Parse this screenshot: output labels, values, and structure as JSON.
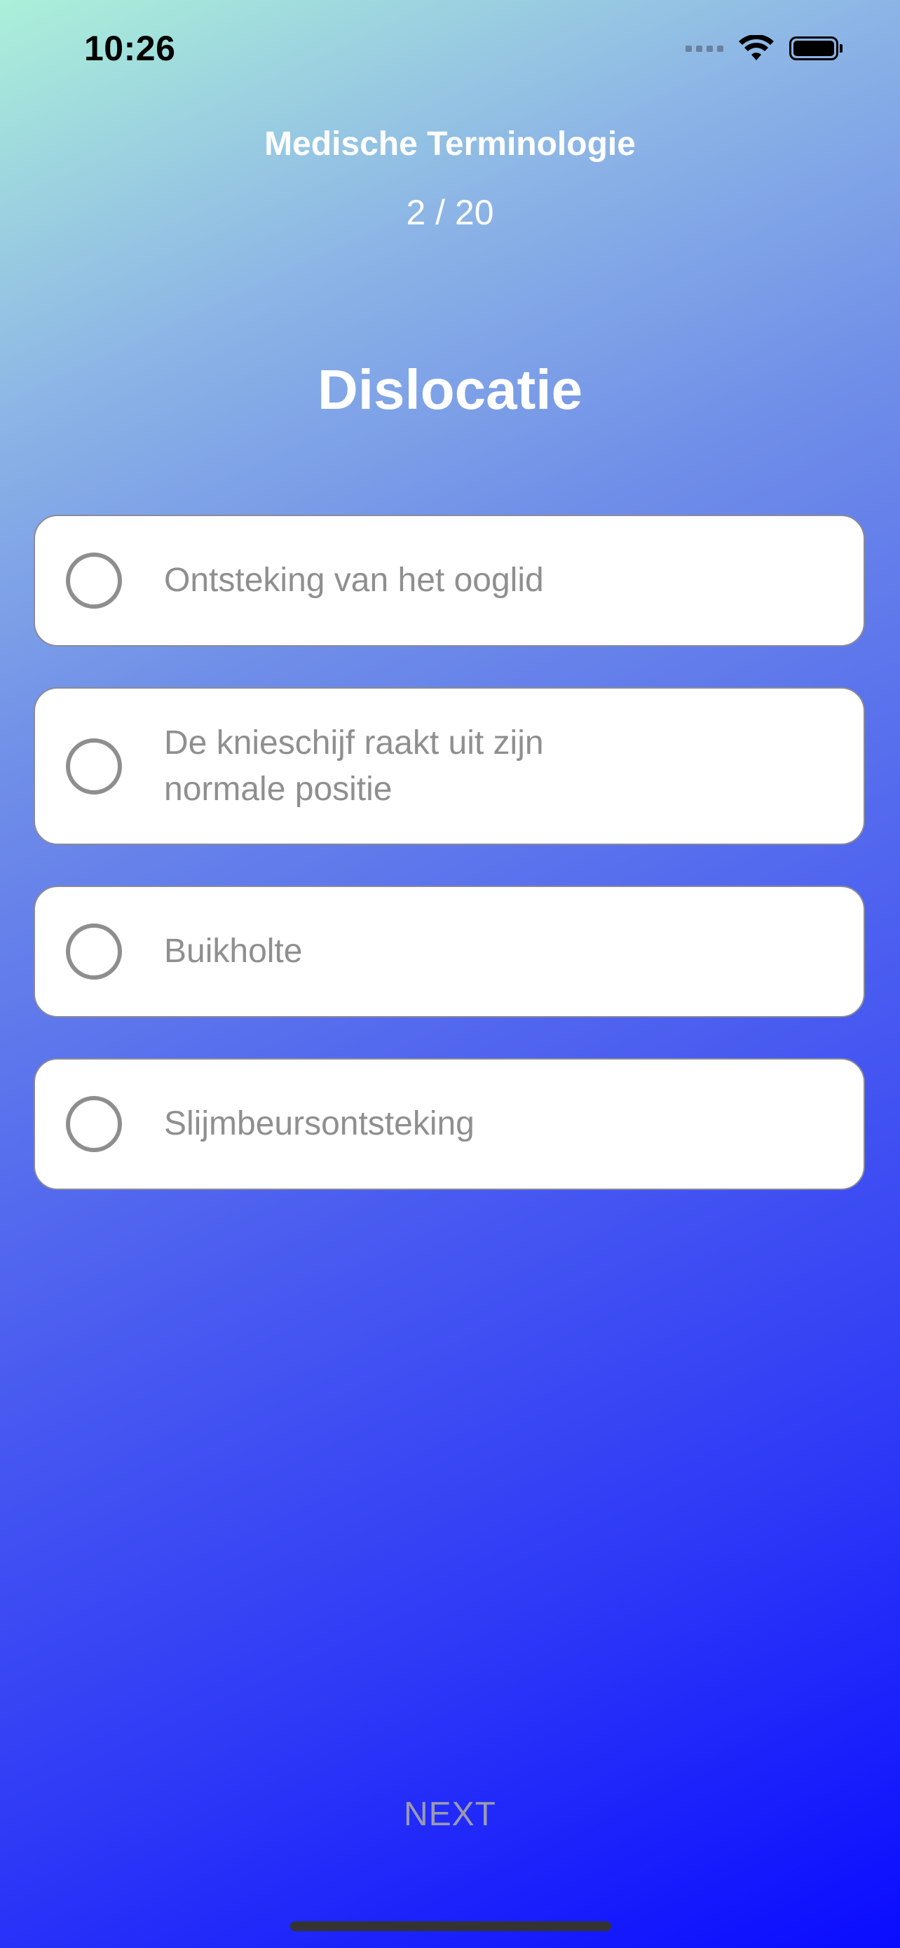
{
  "status_bar": {
    "time": "10:26",
    "icons": [
      "cellular-signal-icon",
      "wifi-icon",
      "battery-icon"
    ]
  },
  "quiz": {
    "title": "Medische Terminologie",
    "progress": "2 / 20",
    "question": "Dislocatie"
  },
  "options": [
    {
      "label": "Ontsteking van het ooglid",
      "selected": false
    },
    {
      "label": "De knieschijf raakt uit zijn\nnormale positie",
      "selected": false
    },
    {
      "label": "Buikholte",
      "selected": false
    },
    {
      "label": "Slijmbeursontsteking",
      "selected": false
    }
  ],
  "footer": {
    "next_label": "NEXT"
  },
  "colors": {
    "gradient_start": "#abf0d9",
    "gradient_end": "#0a0cff",
    "card_background": "#ffffff",
    "option_text": "#8f8f8f",
    "radio_ring": "#8e8e8e"
  }
}
